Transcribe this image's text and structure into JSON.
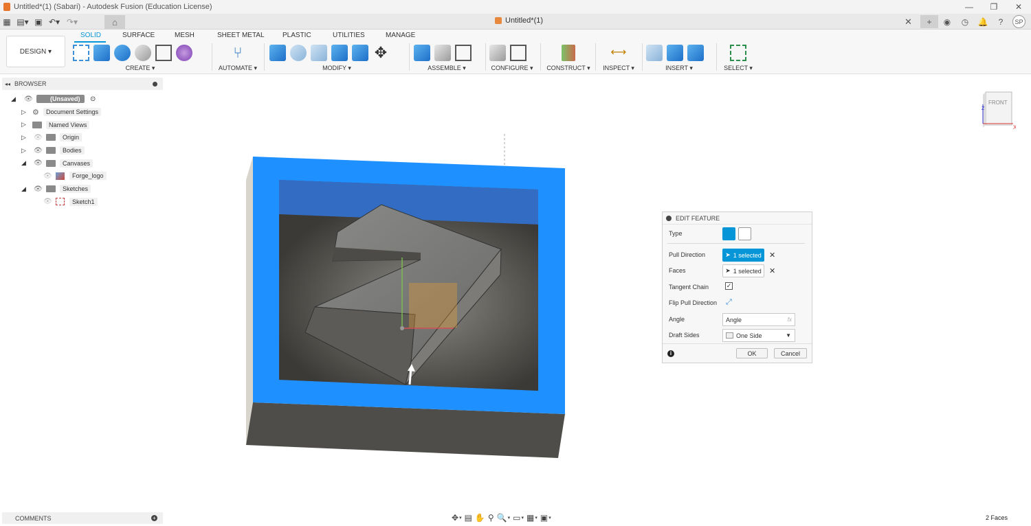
{
  "window": {
    "title": "Untitled*(1) (Sabari) - Autodesk Fusion (Education License)",
    "controls": [
      "—",
      "❐",
      "✕"
    ]
  },
  "tabbar": {
    "doc_tab_label": "Untitled*(1)",
    "avatar_initials": "SP"
  },
  "ribbon": {
    "workspace_label": "DESIGN ▾",
    "tabs": [
      "SOLID",
      "SURFACE",
      "MESH",
      "SHEET METAL",
      "PLASTIC",
      "UTILITIES",
      "MANAGE"
    ],
    "active_tab": "SOLID",
    "groups": [
      "CREATE ▾",
      "AUTOMATE ▾",
      "MODIFY ▾",
      "ASSEMBLE ▾",
      "CONFIGURE ▾",
      "CONSTRUCT ▾",
      "INSPECT ▾",
      "INSERT ▾",
      "SELECT ▾"
    ]
  },
  "browser": {
    "title": "BROWSER",
    "root": "(Unsaved)",
    "items": [
      "Document Settings",
      "Named Views",
      "Origin",
      "Bodies",
      "Canvases",
      "Forge_logo",
      "Sketches",
      "Sketch1"
    ]
  },
  "comments": {
    "title": "COMMENTS"
  },
  "viewcube": {
    "face_label": "FRONT",
    "axis_x": "X",
    "axis_z": "Z"
  },
  "dialog": {
    "title": "EDIT FEATURE",
    "type_label": "Type",
    "pull_direction_label": "Pull Direction",
    "pull_direction_value": "1 selected",
    "faces_label": "Faces",
    "faces_value": "1 selected",
    "tangent_chain_label": "Tangent Chain",
    "tangent_chain_checked": "✓",
    "flip_label": "Flip Pull Direction",
    "angle_label": "Angle",
    "angle_value": "Angle",
    "angle_fx": "fx",
    "draft_sides_label": "Draft Sides",
    "draft_sides_value": "One Side",
    "ok_label": "OK",
    "cancel_label": "Cancel"
  },
  "status": {
    "selection": "2 Faces"
  },
  "colors": {
    "accent": "#0696d7",
    "selection_blue": "#1e90ff",
    "body_dark": "#4a4a46"
  }
}
